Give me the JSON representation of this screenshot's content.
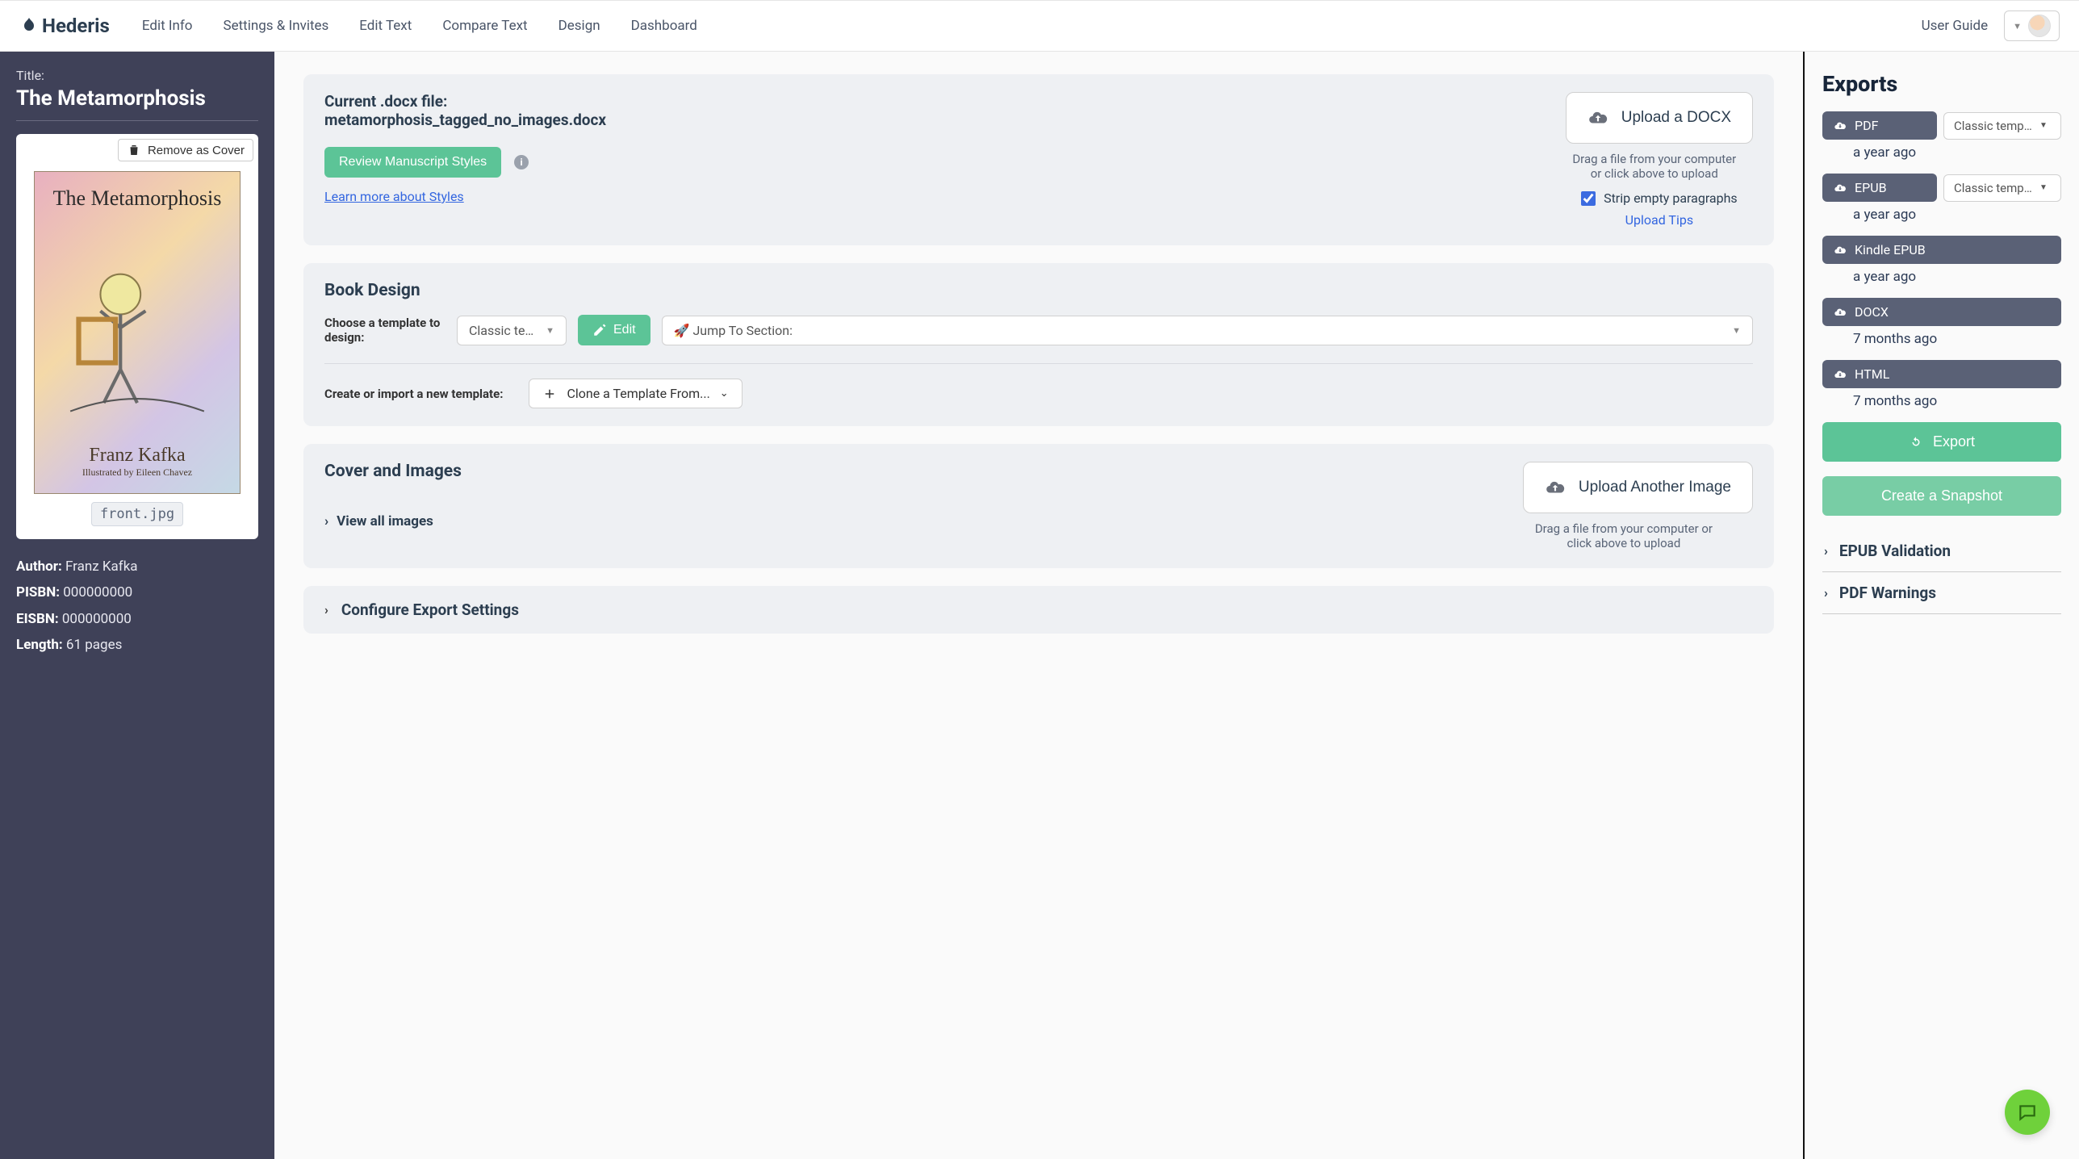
{
  "brand": "Hederis",
  "nav": [
    "Edit Info",
    "Settings & Invites",
    "Edit Text",
    "Compare Text",
    "Design",
    "Dashboard"
  ],
  "user_guide": "User Guide",
  "sidebar": {
    "title_label": "Title:",
    "title": "The Metamorphosis",
    "remove_cover": "Remove as Cover",
    "cover_title": "The Metamorphosis",
    "cover_author": "Franz Kafka",
    "cover_illustrator": "Illustrated by Eileen Chavez",
    "cover_filename": "front.jpg",
    "author_label": "Author:",
    "author": "Franz Kafka",
    "pisbn_label": "PISBN:",
    "pisbn": "000000000",
    "eisbn_label": "EISBN:",
    "eisbn": "000000000",
    "length_label": "Length:",
    "length": "61 pages"
  },
  "docx_panel": {
    "current_label": "Current .docx file:",
    "filename": "metamorphosis_tagged_no_images.docx",
    "upload_btn": "Upload a DOCX",
    "hint": "Drag a file from your computer or click above to upload",
    "review_btn": "Review Manuscript Styles",
    "learn_more": "Learn more about Styles",
    "strip_label": "Strip empty paragraphs",
    "strip_checked": true,
    "upload_tips": "Upload Tips"
  },
  "design_panel": {
    "title": "Book Design",
    "choose_label": "Choose a template to design:",
    "template_selected": "Classic template",
    "edit_btn": "Edit",
    "jump_label": "Jump To Section:",
    "create_label": "Create or import a new template:",
    "clone_btn": "Clone a Template From..."
  },
  "cover_panel": {
    "title": "Cover and Images",
    "upload_btn": "Upload Another Image",
    "hint": "Drag a file from your computer or click above to upload",
    "view_all": "View all images"
  },
  "configure_panel": {
    "title": "Configure Export Settings"
  },
  "exports": {
    "title": "Exports",
    "items": [
      {
        "kind": "PDF",
        "template": "Classic template",
        "time": "a year ago",
        "has_template": true
      },
      {
        "kind": "EPUB",
        "template": "Classic template",
        "time": "a year ago",
        "has_template": true
      },
      {
        "kind": "Kindle EPUB",
        "time": "a year ago",
        "has_template": false
      },
      {
        "kind": "DOCX",
        "time": "7 months ago",
        "has_template": false
      },
      {
        "kind": "HTML",
        "time": "7 months ago",
        "has_template": false
      }
    ],
    "export_btn": "Export",
    "snapshot_btn": "Create a Snapshot",
    "validation": "EPUB Validation",
    "warnings": "PDF Warnings"
  }
}
